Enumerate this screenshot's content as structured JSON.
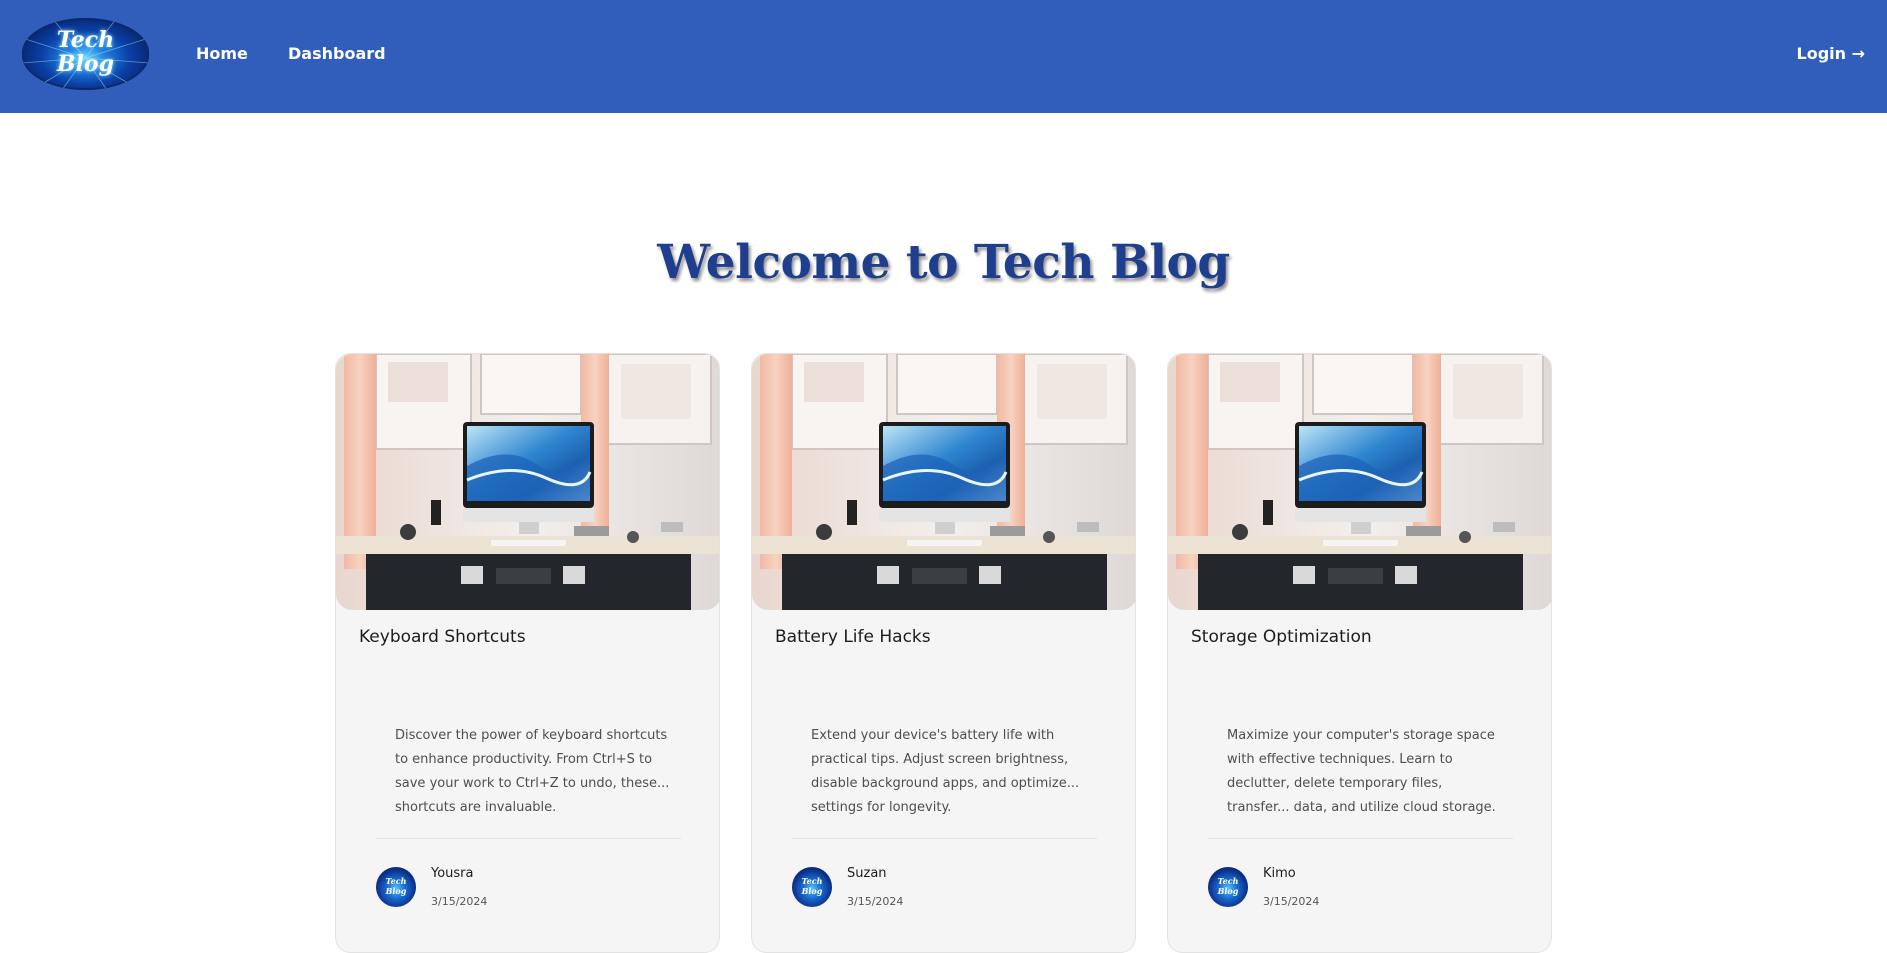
{
  "nav": {
    "logo_line1": "Tech",
    "logo_line2": "Blog",
    "home": "Home",
    "dashboard": "Dashboard",
    "login": "Login →"
  },
  "hero": {
    "title": "Welcome to Tech Blog"
  },
  "posts": [
    {
      "title": "Keyboard Shortcuts",
      "description": "Discover the power of keyboard shortcuts to enhance productivity. From Ctrl+S to save your work to Ctrl+Z to undo, these... shortcuts are invaluable.",
      "author": "Yousra",
      "date": "3/15/2024"
    },
    {
      "title": "Battery Life Hacks",
      "description": "Extend your device's battery life with practical tips. Adjust screen brightness, disable background apps, and optimize... settings for longevity.",
      "author": "Suzan",
      "date": "3/15/2024"
    },
    {
      "title": "Storage Optimization",
      "description": "Maximize your computer's storage space with effective techniques. Learn to declutter, delete temporary files, transfer... data, and utilize cloud storage.",
      "author": "Kimo",
      "date": "3/15/2024"
    }
  ],
  "colors": {
    "navbar": "#315dbb",
    "title": "#1f3f8e",
    "card_bg": "#f5f5f5"
  }
}
